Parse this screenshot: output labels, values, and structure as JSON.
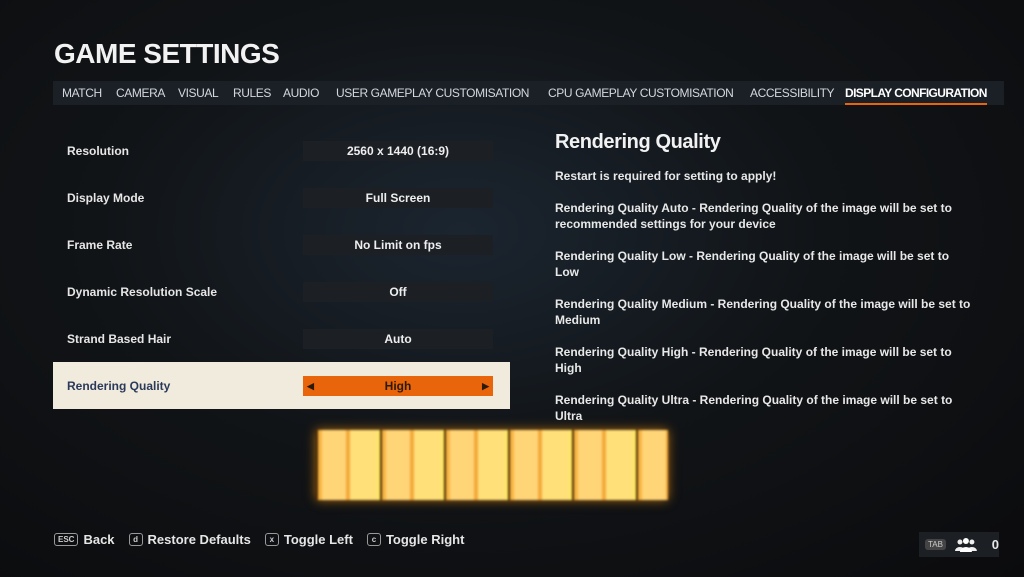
{
  "title": "GAME SETTINGS",
  "tabs": [
    "MATCH",
    "CAMERA",
    "VISUAL",
    "RULES",
    "AUDIO",
    "USER GAMEPLAY CUSTOMISATION",
    "CPU GAMEPLAY CUSTOMISATION",
    "ACCESSIBILITY",
    "DISPLAY CONFIGURATION"
  ],
  "active_tab": "DISPLAY CONFIGURATION",
  "settings": [
    {
      "label": "Resolution",
      "value": "2560 x 1440 (16:9)"
    },
    {
      "label": "Display Mode",
      "value": "Full Screen"
    },
    {
      "label": "Frame Rate",
      "value": "No Limit on fps"
    },
    {
      "label": "Dynamic Resolution Scale",
      "value": "Off"
    },
    {
      "label": "Strand Based Hair",
      "value": "Auto"
    },
    {
      "label": "Rendering Quality",
      "value": "High"
    }
  ],
  "description": {
    "title": "Rendering Quality",
    "lines": [
      "Restart is required for setting to apply!",
      "Rendering Quality Auto - Rendering Quality of the image will be set to recommended settings for your device",
      "Rendering Quality Low - Rendering Quality of the image will be set to Low",
      "Rendering Quality Medium - Rendering Quality of the image will be set to Medium",
      "Rendering Quality High - Rendering Quality of the image will be set to High",
      "Rendering Quality Ultra - Rendering Quality of the image will be set to Ultra"
    ]
  },
  "footer": [
    {
      "key": "ESC",
      "label": "Back"
    },
    {
      "key": "d",
      "label": "Restore Defaults"
    },
    {
      "key": "x",
      "label": "Toggle Left"
    },
    {
      "key": "c",
      "label": "Toggle Right"
    }
  ],
  "players": {
    "key": "TAB",
    "count": "0",
    "icon": "group-icon"
  },
  "colors": {
    "accent": "#e8650c",
    "selected_row": "#f1ebde"
  }
}
